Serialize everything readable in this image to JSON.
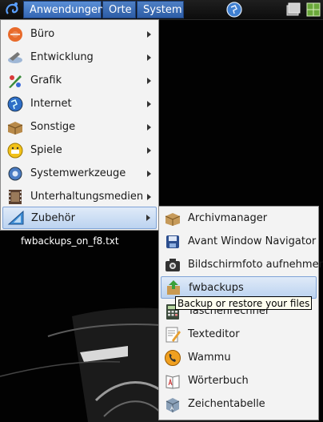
{
  "panel": {
    "menus": [
      {
        "label": "Anwendungen"
      },
      {
        "label": "Orte"
      },
      {
        "label": "System"
      }
    ],
    "icons": {
      "start": "gnome-foot-icon",
      "web": "globe-icon",
      "tray_a": "window-list-icon",
      "tray_b": "workspace-icon"
    }
  },
  "desktop": {
    "file_label": "fwbackups_on_f8.txt"
  },
  "main_menu": {
    "items": [
      {
        "label": "Büro",
        "icon": "office-icon"
      },
      {
        "label": "Entwicklung",
        "icon": "development-icon"
      },
      {
        "label": "Grafik",
        "icon": "graphics-icon"
      },
      {
        "label": "Internet",
        "icon": "internet-icon"
      },
      {
        "label": "Sonstige",
        "icon": "other-icon"
      },
      {
        "label": "Spiele",
        "icon": "games-icon"
      },
      {
        "label": "Systemwerkzeuge",
        "icon": "system-tools-icon"
      },
      {
        "label": "Unterhaltungsmedien",
        "icon": "multimedia-icon"
      },
      {
        "label": "Zubehör",
        "icon": "accessories-icon",
        "highlighted": true
      }
    ]
  },
  "sub_menu": {
    "items": [
      {
        "label": "Archivmanager",
        "icon": "archive-icon"
      },
      {
        "label": "Avant Window Navigator",
        "icon": "awn-icon"
      },
      {
        "label": "Bildschirmfoto aufnehmen",
        "icon": "camera-icon"
      },
      {
        "label": "fwbackups",
        "icon": "backup-icon",
        "highlighted": true
      },
      {
        "label": "Taschenrechner",
        "icon": "calculator-icon"
      },
      {
        "label": "Texteditor",
        "icon": "text-editor-icon"
      },
      {
        "label": "Wammu",
        "icon": "phone-icon"
      },
      {
        "label": "Wörterbuch",
        "icon": "dictionary-icon"
      },
      {
        "label": "Zeichentabelle",
        "icon": "character-map-icon"
      }
    ]
  },
  "tooltip": {
    "text": "Backup or restore your files"
  },
  "colors": {
    "highlight": "#bcd3f0",
    "panel_button": "#3466b3",
    "menu_bg": "#f3f3f3"
  }
}
